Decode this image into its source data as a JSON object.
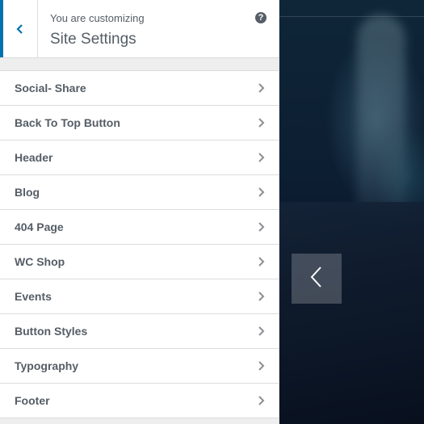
{
  "header": {
    "customizing_label": "You are customizing",
    "title": "Site Settings",
    "help_label": "?",
    "back_icon": "chevron-left-icon",
    "accent_color": "#0073aa"
  },
  "menu": {
    "items": [
      {
        "label": "Social- Share"
      },
      {
        "label": "Back To Top Button"
      },
      {
        "label": "Header"
      },
      {
        "label": "Blog"
      },
      {
        "label": "404 Page"
      },
      {
        "label": "WC Shop"
      },
      {
        "label": "Events"
      },
      {
        "label": "Button Styles"
      },
      {
        "label": "Typography"
      },
      {
        "label": "Footer"
      }
    ],
    "item_icon": "chevron-right-icon"
  },
  "preview": {
    "slider_prev_icon": "chevron-left-icon"
  }
}
